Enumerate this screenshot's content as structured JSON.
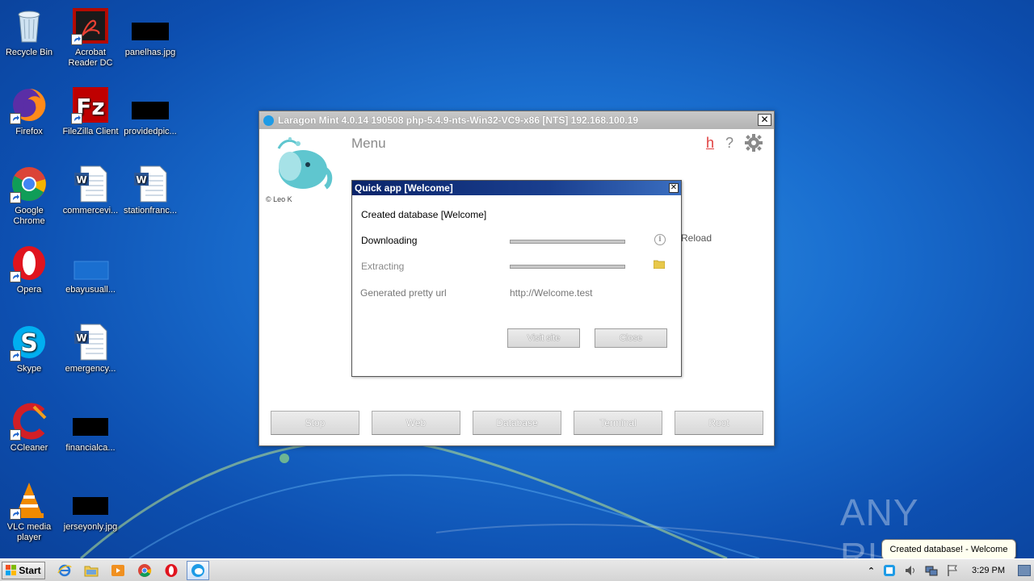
{
  "desktop": {
    "icons": [
      {
        "label": "Recycle Bin",
        "icon": "recycle-bin-icon"
      },
      {
        "label": "Acrobat Reader DC",
        "icon": "acrobat-icon"
      },
      {
        "label": "panelhas.jpg",
        "icon": "image-file-icon"
      },
      {
        "label": "Firefox",
        "icon": "firefox-icon"
      },
      {
        "label": "FileZilla Client",
        "icon": "filezilla-icon"
      },
      {
        "label": "providedpic...",
        "icon": "image-file-icon"
      },
      {
        "label": "Google Chrome",
        "icon": "chrome-icon"
      },
      {
        "label": "commercevi...",
        "icon": "word-doc-icon"
      },
      {
        "label": "stationfranc...",
        "icon": "word-doc-icon"
      },
      {
        "label": "Opera",
        "icon": "opera-icon"
      },
      {
        "label": "ebayusuall...",
        "icon": "file-icon"
      },
      {
        "label": "Skype",
        "icon": "skype-icon"
      },
      {
        "label": "emergency...",
        "icon": "word-doc-icon"
      },
      {
        "label": "CCleaner",
        "icon": "ccleaner-icon"
      },
      {
        "label": "financialca...",
        "icon": "image-file-icon"
      },
      {
        "label": "VLC media player",
        "icon": "vlc-icon"
      },
      {
        "label": "jerseyonly.jpg",
        "icon": "image-file-icon"
      }
    ]
  },
  "laragon": {
    "title": "Laragon Mint 4.0.14 190508 php-5.4.9-nts-Win32-VC9-x86 [NTS]  192.168.100.19",
    "close_glyph": "✕",
    "menu_label": "Menu",
    "h_label": "h",
    "help_label": "?",
    "author": "© Leo K",
    "reload_label": "Reload",
    "buttons": {
      "stop": "Stop",
      "web": "Web",
      "database": "Database",
      "terminal": "Terminal",
      "root": "Root"
    },
    "colors": {
      "accent": "#1e9be6",
      "h_link": "#e04040"
    }
  },
  "quick_app": {
    "title": "Quick app [Welcome]",
    "close_glyph": "✕",
    "created_label": "Created database [Welcome]",
    "downloading_label": "Downloading",
    "downloading_progress": 1.0,
    "extracting_label": "Extracting",
    "extracting_progress": 1.0,
    "pretty_url_label": "Generated pretty url",
    "pretty_url_value": "http://Welcome.test",
    "info_glyph": "i",
    "visit_site_label": "Visit site",
    "close_label": "Close"
  },
  "watermark": "ANY RUN",
  "balloon": {
    "text": "Created database! - Welcome"
  },
  "taskbar": {
    "start_label": "Start",
    "clock": "3:29 PM",
    "pinned": [
      "internet-explorer-icon",
      "explorer-folder-icon",
      "media-player-icon",
      "chrome-icon",
      "opera-icon",
      "laragon-icon"
    ],
    "active": "laragon-icon",
    "tray_expand_glyph": "⌃"
  }
}
